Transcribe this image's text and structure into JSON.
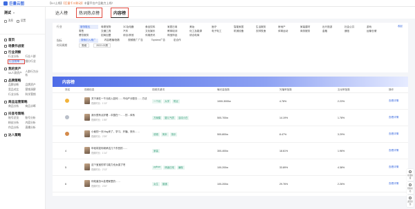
{
  "topbar": {
    "logo": "巨量云图",
    "notice_prefix": "【5.0上线】",
    "notice_highlight": "【巨量千川联动】",
    "notice_rest": "丰富平台产品能力上线！"
  },
  "sidebar": {
    "user_name": "测试",
    "quick": [
      "消息",
      "设置"
    ],
    "sections": [
      {
        "title": "首页",
        "items": []
      },
      {
        "title": "场景作战室",
        "items": []
      },
      {
        "title": "行业洞察",
        "items": [
          "行业分析",
          "行业人群",
          "行业榜单",
          "细分行业"
        ],
        "active_index": 2
      },
      {
        "title": "我的资产",
        "items": [
          "5A人群资产",
          "人群行为分析"
        ]
      },
      {
        "title": "品牌策略",
        "items": [
          "品牌诊断",
          "品牌资产",
          "竞品对比",
          "营销洞察",
          "行业分析",
          "科学营销"
        ]
      },
      {
        "title": "商品运营策略",
        "items": [
          "商品分析",
          "商品诊断"
        ]
      },
      {
        "title": "抖音号策略",
        "items": [
          "账号总览",
          "账号分析",
          "粉丝分析",
          "内容分析",
          "作品分析",
          "直播分析"
        ]
      },
      {
        "title": "达人策略",
        "items": []
      }
    ]
  },
  "tabs": [
    "达人榜",
    "热词热点榜",
    "内容榜"
  ],
  "filters": {
    "industry_label": "行业",
    "industry_options": [
      "服饰鞋包",
      "母婴宠物",
      "3C及电器",
      "食品饮料",
      "家居日用",
      "美妆",
      "医疗",
      "智能家居",
      "生活服务",
      "房地产",
      "家装建材",
      "出行旅游",
      "社会公共",
      "游戏",
      "零售",
      "交通工具",
      "汽车",
      "文化娱乐",
      "教育培训",
      "化工及能源",
      "电子电工",
      "机械设备",
      "农林牧渔",
      "体育运动",
      "商务服务",
      "金融",
      "通信",
      "运输仓储",
      "餐饮服务",
      "招商加盟",
      "综合/其他",
      "传媒资讯",
      "珠宝饰品",
      "综合电商"
    ],
    "collapse_label": "收起",
    "metric_label": "指标",
    "metric_options": [
      "搜索引入推广",
      "内容看播/指数",
      "视频推广广告",
      "Topview广告",
      "定合作"
    ],
    "date_label": "时间周期",
    "period": "周维",
    "date_value": "2022-02周"
  },
  "banner_title": "内容榜",
  "table": {
    "headers": [
      "排名",
      "视频信息",
      "视频关键词",
      "曝光量指数",
      "完播率指数",
      "互动率指数",
      "操作"
    ],
    "rows": [
      {
        "rank": "1",
        "medal": "#f2b33a",
        "title": "关于我在一千元收入如何……不动产分配去……方法",
        "duration": "视频时长：1'13\"",
        "tags": [
          "一个月",
          "大学",
          "附近"
        ],
        "likes": "1000-3000w",
        "completion": "4.78%",
        "rate": "2.23%",
        "op": "查看详情"
      },
      {
        "rank": "2",
        "medal": "#b9bfc9",
        "title": "我头很有点好看…中国在一……的…体系",
        "duration": "视频时长：1'55\"",
        "tags": [
          "方案模",
          "婴儿气质",
          "活动小白"
        ],
        "likes": "500-700w",
        "completion": "14.19%",
        "rate": "1.78%",
        "op": "查看详情"
      },
      {
        "rank": "3",
        "medal": "#d48a4a",
        "title": "小秘的一天Vlog来了，学习、开播、快乐……",
        "duration": "视频时长：2'39\"",
        "tags": [
          "说唱",
          "简本",
          "快乐"
        ],
        "likes": "500-800w",
        "completion": "8.47%",
        "rate": "3.29%",
        "op": "查看详情"
      },
      {
        "rank": "4",
        "medal": "",
        "title": "年轻将如何继承这几个东西的……",
        "duration": "视频时长：1'14\"",
        "tags": [
          "家装"
        ],
        "likes": "300-400w",
        "completion": "18.61%",
        "rate": "1.96%",
        "op": "查看详情"
      },
      {
        "rank": "5",
        "medal": "",
        "title": "这个宝宝的学习能力也太强了吧",
        "duration": "视频时长：2'13\"",
        "tags": [
          "python",
          "情绪日常",
          "编程"
        ],
        "likes": "100-200w",
        "completion": "33.89%",
        "rate": "4.38%",
        "op": "查看详情"
      },
      {
        "rank": "6",
        "medal": "",
        "title": "你知道怎么处理家里的……",
        "duration": "视频时长：2'20\"",
        "tags": [
          "女生",
          "普通"
        ],
        "likes": "100-200w",
        "completion": "29.76%",
        "rate": "2.26%",
        "op": "查看详情"
      }
    ]
  },
  "float_buttons": [
    "在线客服",
    "帮助文档",
    "返回顶部"
  ]
}
